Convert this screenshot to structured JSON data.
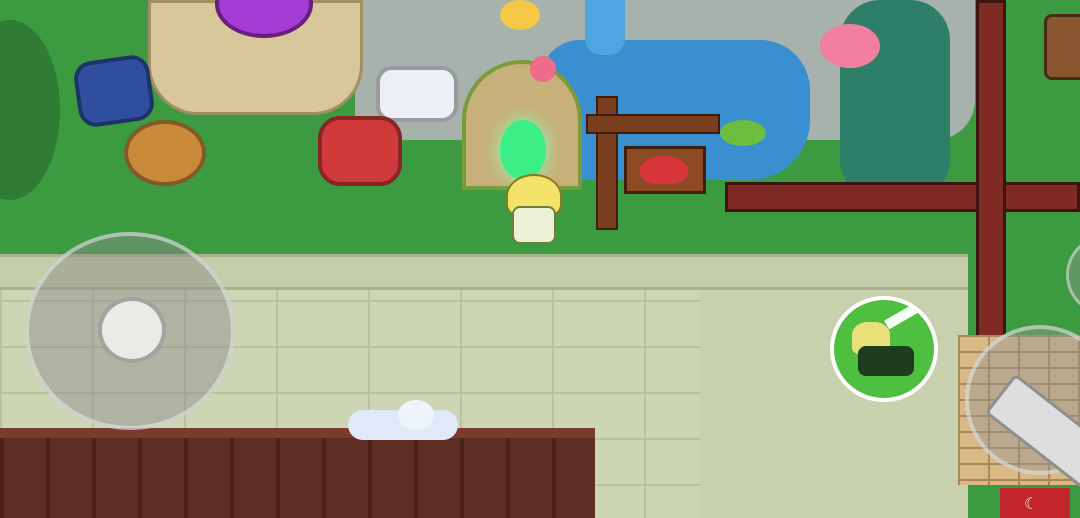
{
  "scene": {
    "name": "game-hub-garden",
    "colors": {
      "grass": "#3c9a40",
      "plaza_stone": "#cdd6b4",
      "water": "#3a8fd0",
      "fence": "#7f2a22",
      "roof": "#5e2e24",
      "portal": "#3bef86"
    }
  },
  "hud": {
    "joystick": {
      "icon": "virtual-joystick"
    },
    "skill_button": {
      "icon": "character-skill-portrait-icon"
    },
    "attack_button": {
      "icon": "sword-icon"
    },
    "side_button": {
      "icon": "side-action-icon"
    }
  },
  "world": {
    "gems": [
      "blue",
      "white",
      "brown",
      "red"
    ],
    "sign": {
      "icon": "heart-sign-icon"
    },
    "banner": {
      "glyph": "☾"
    }
  }
}
